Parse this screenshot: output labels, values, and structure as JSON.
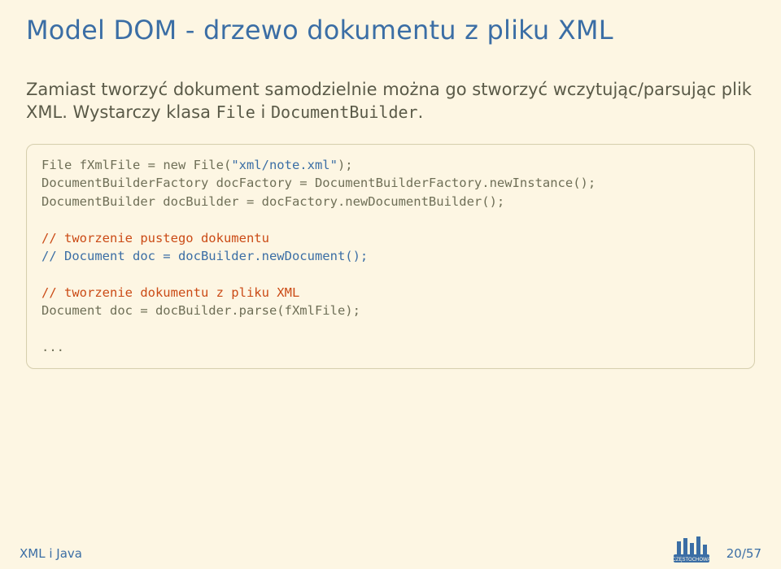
{
  "title": "Model DOM - drzewo dokumentu z pliku XML",
  "paragraph": {
    "text_before": "Zamiast tworzyć dokument samodzielnie można go stworzyć wczytując/parsując plik XML. Wystarczy klasa ",
    "code1": "File",
    "text_mid": " i ",
    "code2": "DocumentBuilder",
    "text_after": "."
  },
  "code": {
    "l1a": "File fXmlFile = ",
    "l1b": "new",
    "l1c": " File(",
    "l1d": "\"xml/note.xml\"",
    "l1e": ");",
    "l2": "DocumentBuilderFactory docFactory = DocumentBuilderFactory.newInstance();",
    "l3": "DocumentBuilder docBuilder = docFactory.newDocumentBuilder();",
    "l4": "",
    "l5": "// tworzenie pustego dokumentu",
    "l6": "// Document doc = docBuilder.newDocument();",
    "l7": "",
    "l8": "// tworzenie dokumentu z pliku XML",
    "l9": "Document doc = docBuilder.parse(fXmlFile);",
    "l10": "",
    "l11": "..."
  },
  "footer": {
    "left": "XML i Java",
    "right": "20/57"
  }
}
